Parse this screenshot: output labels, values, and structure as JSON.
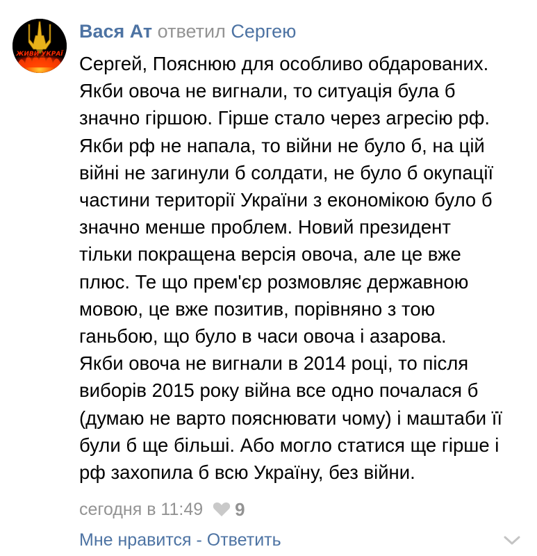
{
  "comment": {
    "author": "Вася Ат",
    "replied_label": "ответил",
    "reply_to": "Сергею",
    "text_lines": [
      "Сергей, Пояснюю для особливо обдарованих.",
      "Якби овоча не вигнали, то ситуація була б",
      "значно гіршою. Гірше стало через агресію рф.",
      "Якби рф не напала, то війни не було б, на цій",
      "війні не загинули б солдати, не було б окупації",
      "частини території України з економікою було б",
      "значно менше проблем. Новий президент",
      "тільки покращена версія овоча, але це вже",
      "плюс. Те що прем'єр розмовляє державною",
      "мовою, це вже позитив, порівняно з тою",
      "ганьбою, що було в часи овоча і азарова.",
      "Якби овоча не вигнали в 2014 році, то після",
      "виборів 2015 року війна все одно почалася б",
      "(думаю не варто пояснювати чому) і маштаби її",
      "були б ще більші. Або могло статися ще гірше і",
      "рф захопила б всю Україну, без війни."
    ],
    "timestamp": "сегодня в 11:49",
    "likes_count": "9",
    "like_action": "Мне нравится",
    "separator": " - ",
    "reply_action": "Ответить",
    "avatar_text": "ЖИВИ УКРАЇ"
  },
  "icons": {
    "heart": "heart-icon",
    "chevron": "chevron-down-icon",
    "avatar_emblem": "trident-icon"
  },
  "colors": {
    "link": "#4d73a3",
    "muted": "#939393",
    "text": "#000000",
    "heart": "#c9c9c9"
  }
}
